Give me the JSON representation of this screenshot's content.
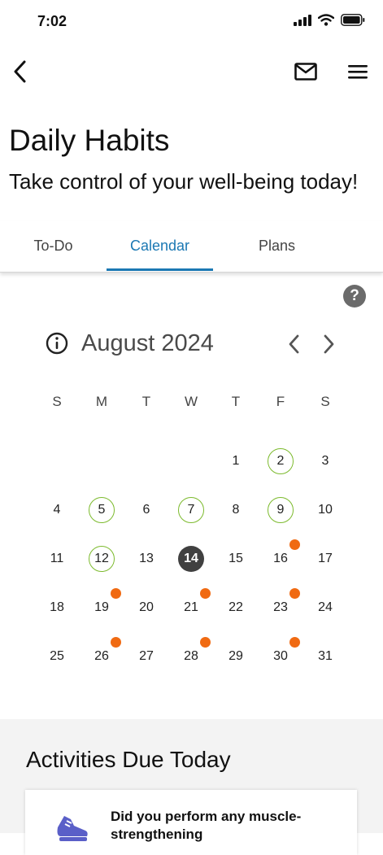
{
  "status": {
    "time": "7:02"
  },
  "header": {
    "title": "Daily Habits",
    "subtitle": "Take control of your well-being today!"
  },
  "tabs": [
    {
      "label": "To-Do"
    },
    {
      "label": "Calendar",
      "active": true
    },
    {
      "label": "Plans"
    }
  ],
  "help": {
    "label": "?"
  },
  "calendar": {
    "month": "August 2024",
    "weekdays": [
      "S",
      "M",
      "T",
      "W",
      "T",
      "F",
      "S"
    ],
    "first_weekday_index": 4,
    "days_in_month": 31,
    "today": 14,
    "completed_days": [
      2,
      5,
      7,
      9,
      12
    ],
    "scheduled_days": [
      16,
      19,
      21,
      23,
      26,
      28,
      30
    ],
    "colors": {
      "completed_ring": "#7cba2d",
      "scheduled_dot": "#f06a12",
      "today_fill": "#404040",
      "accent": "#1b78b3"
    }
  },
  "activities": {
    "title": "Activities Due Today",
    "items": [
      {
        "icon": "sneaker-icon",
        "text": "Did you perform any muscle-strengthening"
      }
    ]
  }
}
